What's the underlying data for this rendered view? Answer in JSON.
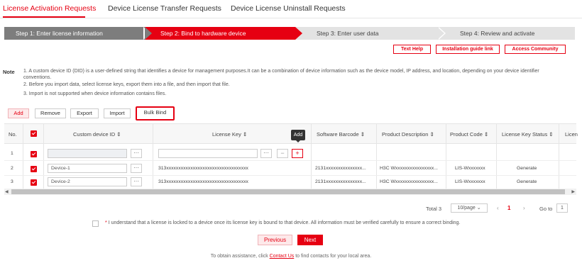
{
  "tabs": [
    {
      "label": "License Activation Requests",
      "active": true
    },
    {
      "label": "Device License Transfer Requests",
      "active": false
    },
    {
      "label": "Device License Uninstall Requests",
      "active": false
    }
  ],
  "steps": [
    {
      "label": "Step 1: Enter license information",
      "state": "done"
    },
    {
      "label": "Step 2: Bind to hardware device",
      "state": "active"
    },
    {
      "label": "Step 3: Enter user data",
      "state": "pending"
    },
    {
      "label": "Step 4: Review and activate",
      "state": "pending"
    }
  ],
  "help": {
    "text_help": "Text Help",
    "install_guide": "Installation guide link",
    "access_community": "Access Community"
  },
  "note": {
    "label": "Note",
    "lines": [
      "1. A custom device ID (DID) is a user-defined string that identifies a device for management purposes.It can be a combination of device information such as the device model, IP address, and location, depending on your device identifier",
      "conventions.",
      "2. Before you import data, select license keys, export them into a file, and then import that file.",
      "3. Import is not supported when device information contains files."
    ]
  },
  "toolbar": {
    "add": "Add",
    "remove": "Remove",
    "export": "Export",
    "import": "Import",
    "bulk_bind": "Bulk Bind"
  },
  "table": {
    "headers": {
      "no": "No.",
      "custom_device_id": "Custom device ID",
      "license_key": "License Key",
      "software_barcode": "Software Barcode",
      "product_description": "Product Description",
      "product_code": "Product Code",
      "license_key_status": "License Key Status",
      "license_truncated": "Licen"
    },
    "tooltip": "Add",
    "rows": [
      {
        "no": "1",
        "device_id": "",
        "license_key": "",
        "barcode": "",
        "description": "",
        "code": "",
        "status": ""
      },
      {
        "no": "2",
        "device_id": "Device-1",
        "license_key": "313xxxxxxxxxxxxxxxxxxxxxxxxxxxxxxxxxx",
        "barcode": "2131xxxxxxxxxxxxxxx...",
        "description": "H3C Wxxxxxxxxxxxxxxxx...",
        "code": "LIS-Wxxxxxxx",
        "status": "Generate"
      },
      {
        "no": "3",
        "device_id": "Device-2",
        "license_key": "313xxxxxxxxxxxxxxxxxxxxxxxxxxxxxxxxxx",
        "barcode": "2131xxxxxxxxxxxxxxx...",
        "description": "H3C Wxxxxxxxxxxxxxxxx...",
        "code": "LIS-Wxxxxxxx",
        "status": "Generate"
      }
    ]
  },
  "pagination": {
    "total": "Total 3",
    "page_size": "10/page",
    "current_page": "1",
    "goto_label": "Go to",
    "goto_value": "1"
  },
  "agreement": "I understand that a license is locked to a device once its license key is bound to that device. All information must be verified carefully to ensure a correct binding.",
  "buttons": {
    "previous": "Previous",
    "next": "Next"
  },
  "footer": {
    "before": "To obtain assistance, click ",
    "link": "Contact Us",
    "after": " to find contacts for your local area."
  }
}
